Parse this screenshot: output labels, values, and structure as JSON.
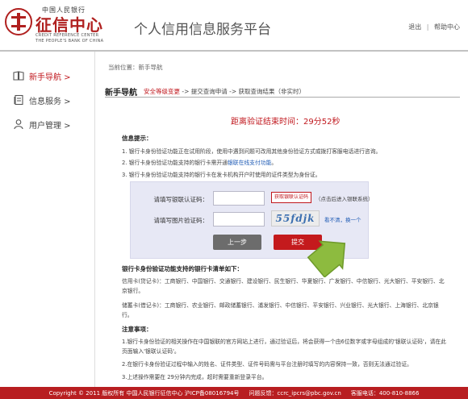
{
  "header": {
    "logo_small": "中国人民银行",
    "logo_big": "征信中心",
    "logo_en_1": "CREDIT REFERENCE CENTER",
    "logo_en_2": "THE PEOPLE'S BANK OF CHINA",
    "platform_title": "个人信用信息服务平台",
    "link_logout": "退出",
    "link_sep": "|",
    "link_help": "帮助中心"
  },
  "sidebar": {
    "items": [
      {
        "label": "新手导航 >",
        "icon": "book-icon",
        "active": true
      },
      {
        "label": "信息服务 >",
        "icon": "document-icon",
        "active": false
      },
      {
        "label": "用户管理 >",
        "icon": "user-icon",
        "active": false
      }
    ]
  },
  "main": {
    "breadcrumb": "当前位置：新手导航",
    "section_title": "新手导航",
    "steps_active": "安全等级变更",
    "steps_rest": " -> 提交查询申请 -> 获取查询结果（非实时）",
    "countdown_label": "距离验证结束时间：",
    "countdown_value": "29分52秒",
    "info_title": "信息提示：",
    "info_1": "1. 银行卡身份验证功能正在试用阶段，使用中遇到问题可改用其他身份验证方式或拨打客服电话进行咨询。",
    "info_2_pre": "2. 银行卡身份验证功能支持的银行卡需开通",
    "info_2_link": "银联在线支付功能",
    "info_2_post": "。",
    "info_3": "3. 银行卡身份验证功能支持的银行卡在发卡机构开户时使用的证件类型为身份证。"
  },
  "form": {
    "label_unionpay_code": "请填写银联认证码：",
    "get_code_button": "获取银联认证码",
    "hint": "（点击后进入银联系统）",
    "label_captcha": "请填写图片验证码：",
    "captcha_text": "55fdjk",
    "refresh_link": "看不清，换一个",
    "prev_button": "上一步",
    "submit_button": "提交"
  },
  "banks": {
    "title": "银行卡身份验证功能支持的银行卡清单如下：",
    "credit": "信用卡(贷记卡)：工商银行、中国银行、交通银行、建设银行、民生银行、华夏银行、广发银行、中信银行、光大银行、平安银行、北京银行。",
    "debit": "储蓄卡(借记卡)：工商银行、农业银行、邮政储蓄银行、浦发银行、中信银行、平安银行、兴业银行、光大银行、上海银行、北京银行。"
  },
  "notes": {
    "title": "注意事项：",
    "n1": "1.银行卡身份验证的相关操作在中国银联的官方网站上进行，通过验证后，将会获得一个由6位数字或字母组成的'银联认证码'，请在此页面输入'银联认证码'。",
    "n2": "2.在银行卡身份验证过程中输入的姓名、证件类型、证件号码需与平台注册时填写的内容保持一致，否则无法通过验证。",
    "n3": "3.上述操作需要在 29分钟内完成，超时需要重新登录平台。"
  },
  "footer": {
    "copyright": "Copyright © 2011  版权所有  中国人民银行征信中心  沪ICP备08016794号",
    "email": "问题反馈：ccrc_ipcrs@pbc.gov.cn",
    "phone": "客服电话：400-810-8866"
  },
  "colors": {
    "brand_red": "#c0171d",
    "form_bg": "#e7e8f5",
    "arrow_green": "#8dbb3f"
  }
}
